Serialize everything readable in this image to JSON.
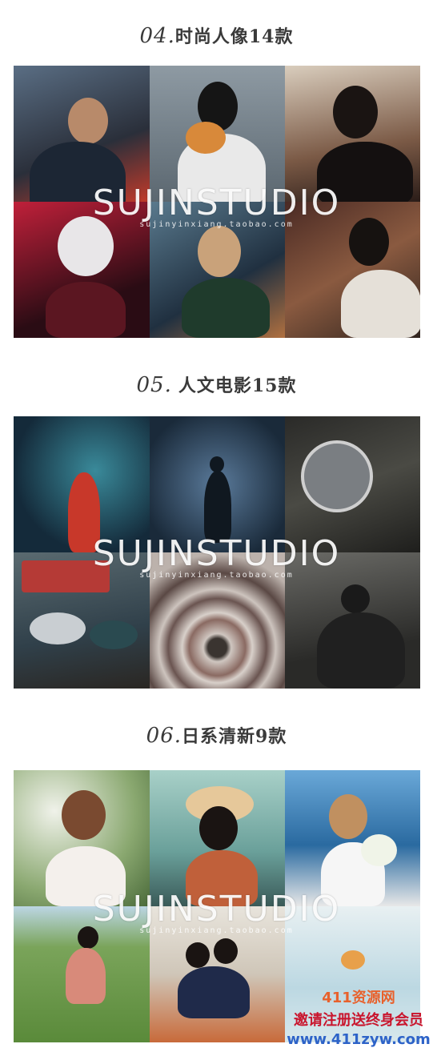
{
  "sections": [
    {
      "num": "04.",
      "text": "时尚人像14款"
    },
    {
      "num": "05.",
      "text": "人文电影15款"
    },
    {
      "num": "06.",
      "text": "日系清新9款"
    }
  ],
  "watermark": {
    "brand": "SUJINSTUDIO",
    "url": "sujinyinxiang.taobao.com"
  },
  "badge": {
    "site": "411资源网",
    "promo": "邀请注册送终身会员",
    "domain": "www.411zyw.com"
  },
  "colors": {
    "title": "#3a3a3a",
    "site": "#e8612c",
    "promo": "#c9152d",
    "domain": "#2d63c8"
  }
}
